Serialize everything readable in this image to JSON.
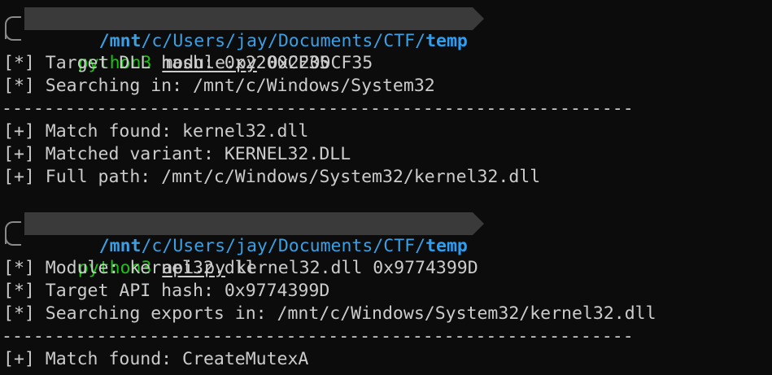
{
  "colors": {
    "background": "#0c0c0c",
    "text": "#cccccc",
    "exe": "#16c60c",
    "path": "#3b9fe2",
    "path_bg": "#3a3a3a"
  },
  "blocks": [
    {
      "prompt": {
        "path_parts": [
          "/",
          "mnt",
          "/",
          "c",
          "/",
          "Users",
          "/",
          "jay",
          "/",
          "Documents",
          "/",
          "CTF",
          "/",
          "temp"
        ],
        "path_text": "/mnt/c/Users/jay/Documents/CTF/temp"
      },
      "command": {
        "exe": "python3",
        "script": "module.py",
        "args": "0x2200CF35"
      },
      "output_before_sep": [
        "[*] Target DLL hash: 0x2200CF35",
        "[*] Searching in: /mnt/c/Windows/System32"
      ],
      "separator": "------------------------------------------------------------",
      "output_after_sep": [
        "[+] Match found: kernel32.dll",
        "[+] Matched variant: KERNEL32.DLL",
        "[+] Full path: /mnt/c/Windows/System32/kernel32.dll"
      ]
    },
    {
      "prompt": {
        "path_text": "/mnt/c/Users/jay/Documents/CTF/temp"
      },
      "command": {
        "exe": "python3",
        "script": "api.py",
        "args": "kernel32.dll 0x9774399D"
      },
      "output_before_sep": [
        "[*] Module: kernel32.dll",
        "[*] Target API hash: 0x9774399D",
        "[*] Searching exports in: /mnt/c/Windows/System32/kernel32.dll"
      ],
      "separator": "------------------------------------------------------------",
      "output_after_sep": [
        "[+] Match found: CreateMutexA"
      ]
    }
  ]
}
